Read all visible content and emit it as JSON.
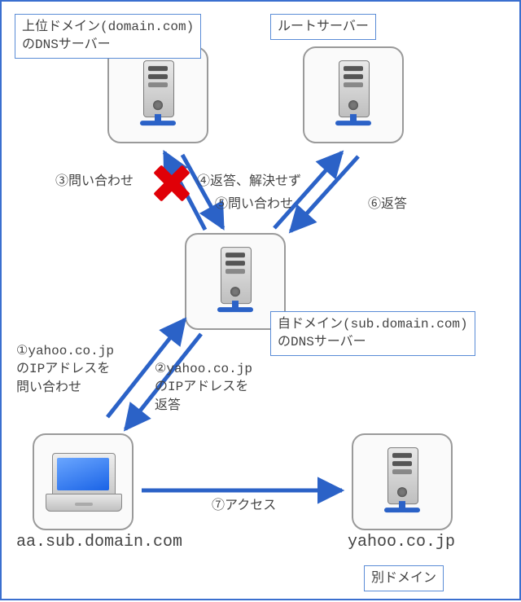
{
  "domain": "Diagram",
  "topic": "DNS name resolution flow (iterative lookup)",
  "nodes": {
    "upper_dns": {
      "label": "上位ドメイン(domain.com)\nのDNSサーバー"
    },
    "root": {
      "label": "ルートサーバー"
    },
    "local_dns": {
      "label": "自ドメイン(sub.domain.com)\nのDNSサーバー"
    },
    "client": {
      "hostname": "aa.sub.domain.com"
    },
    "target": {
      "hostname": "yahoo.co.jp"
    },
    "target_note": {
      "label": "別ドメイン"
    }
  },
  "steps": {
    "s1": "①yahoo.co.jp\nのIPアドレスを\n問い合わせ",
    "s2": "②yahoo.co.jp\nのIPアドレスを\n返答",
    "s3": "③問い合わせ",
    "s4": "④返答、解決せず",
    "s5": "⑤問い合わせ",
    "s6": "⑥返答",
    "s7": "⑦アクセス"
  },
  "failure_mark": "x",
  "colors": {
    "arrow": "#2b62c7",
    "box_border": "#5a8cd6",
    "failure": "#e00007"
  }
}
